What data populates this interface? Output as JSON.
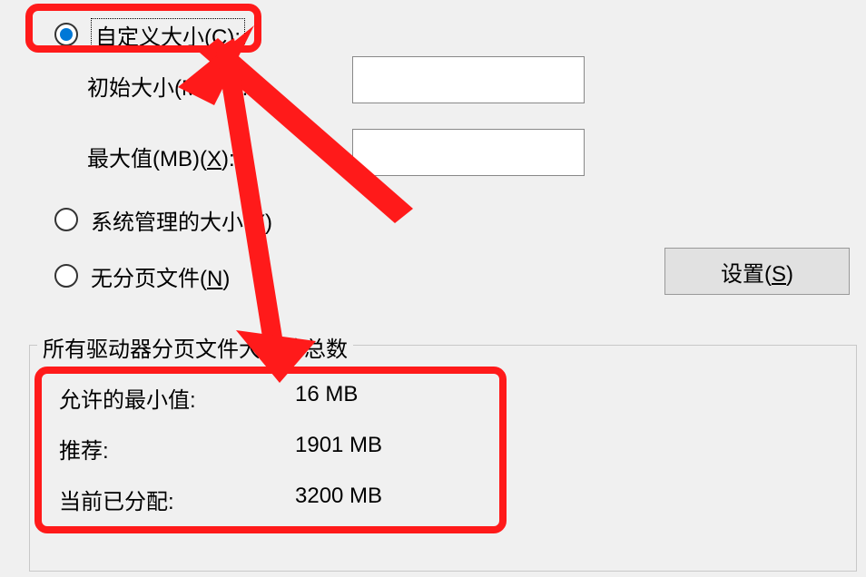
{
  "options": {
    "custom_size_label": "自定义大小(C):",
    "initial_size_label": "初始大小(MB)(I):",
    "max_size_label": "最大值(MB)(X):",
    "system_managed_label": "系统管理的大小(Y)",
    "no_paging_label": "无分页文件(N)"
  },
  "set_button_label": "设置(S)",
  "group_title": "所有驱动器分页文件大小的总数",
  "totals": {
    "min_label": "允许的最小值:",
    "min_value": "16 MB",
    "rec_label": "推荐:",
    "rec_value": "1901 MB",
    "cur_label": "当前已分配:",
    "cur_value": "3200 MB"
  },
  "inputs": {
    "initial_value": "",
    "max_value": ""
  }
}
